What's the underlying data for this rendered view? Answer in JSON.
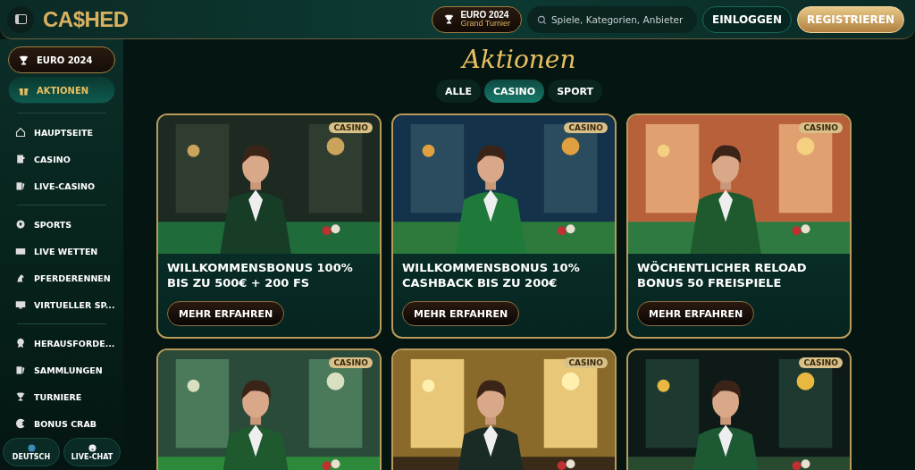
{
  "header": {
    "logo": "CA$HED",
    "event": {
      "title": "EURO 2024",
      "subtitle": "Grand Turnier"
    },
    "search": {
      "placeholder": "Spiele, Kategorien, Anbieter"
    },
    "buttons": [
      {
        "label": "EINLOGGEN",
        "kind": "login"
      },
      {
        "label": "REGISTRIEREN",
        "kind": "register"
      }
    ]
  },
  "sidebar": {
    "featured": [
      {
        "label": "EURO 2024",
        "selected": false
      },
      {
        "label": "AKTIONEN",
        "selected": true
      }
    ],
    "groups": [
      [
        {
          "label": "HAUPTSEITE"
        },
        {
          "label": "CASINO"
        },
        {
          "label": "LIVE-CASINO"
        }
      ],
      [
        {
          "label": "SPORTS"
        },
        {
          "label": "LIVE WETTEN"
        },
        {
          "label": "PFERDERENNEN"
        },
        {
          "label": "VIRTUELLER SP..."
        }
      ],
      [
        {
          "label": "HERAUSFORDE..."
        },
        {
          "label": "SAMMLUNGEN"
        },
        {
          "label": "TURNIERE"
        },
        {
          "label": "BONUS CRAB"
        }
      ]
    ],
    "footer": [
      {
        "label": "DEUTSCH"
      },
      {
        "label": "LIVE-CHAT"
      }
    ]
  },
  "page_title": "Aktionen",
  "filters": [
    {
      "label": "ALLE",
      "selected": false
    },
    {
      "label": "CASINO",
      "selected": true
    },
    {
      "label": "SPORT",
      "selected": false
    }
  ],
  "promotions": [
    {
      "badge": "CASINO",
      "title": "WILLKOMMENSBONUS 100% BIS ZU 500€ + 200 FS",
      "button": "MEHR ERFAHREN"
    },
    {
      "badge": "CASINO",
      "title": "WILLKOMMENSBONUS 10% CASHBACK BIS ZU 200€",
      "button": "MEHR ERFAHREN"
    },
    {
      "badge": "CASINO",
      "title": "WÖCHENTLICHER RELOAD BONUS 50 FREISPIELE",
      "button": "MEHR ERFAHREN"
    },
    {
      "badge": "CASINO"
    },
    {
      "badge": "CASINO"
    },
    {
      "badge": "CASINO"
    }
  ]
}
